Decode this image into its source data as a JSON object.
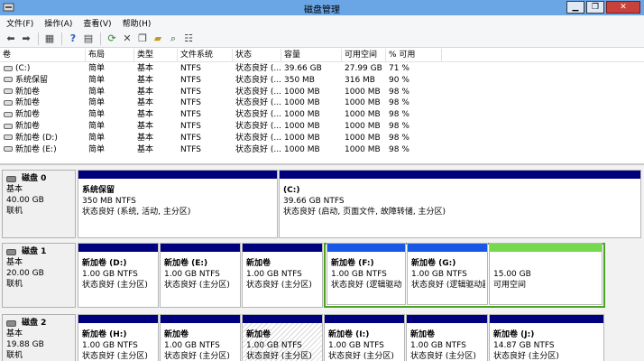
{
  "window": {
    "title": "磁盘管理",
    "min": "▁",
    "max": "❐",
    "close": "✕"
  },
  "menu": [
    "文件(F)",
    "操作(A)",
    "查看(V)",
    "帮助(H)"
  ],
  "toolbar": [
    "back-icon",
    "forward-icon",
    "console-icon",
    "help-icon",
    "properties-icon",
    "refresh-icon",
    "delete-icon",
    "copy-icon",
    "open-icon",
    "search-icon",
    "settings-icon"
  ],
  "volumes": {
    "headers": [
      "卷",
      "布局",
      "类型",
      "文件系统",
      "状态",
      "容量",
      "可用空间",
      "% 可用"
    ],
    "rows": [
      [
        "(C:)",
        "简单",
        "基本",
        "NTFS",
        "状态良好 (...",
        "39.66 GB",
        "27.99 GB",
        "71 %"
      ],
      [
        "系统保留",
        "简单",
        "基本",
        "NTFS",
        "状态良好 (...",
        "350 MB",
        "316 MB",
        "90 %"
      ],
      [
        "新加卷",
        "简单",
        "基本",
        "NTFS",
        "状态良好 (...",
        "1000 MB",
        "1000 MB",
        "98 %"
      ],
      [
        "新加卷",
        "简单",
        "基本",
        "NTFS",
        "状态良好 (...",
        "1000 MB",
        "1000 MB",
        "98 %"
      ],
      [
        "新加卷",
        "简单",
        "基本",
        "NTFS",
        "状态良好 (...",
        "1000 MB",
        "1000 MB",
        "98 %"
      ],
      [
        "新加卷",
        "简单",
        "基本",
        "NTFS",
        "状态良好 (...",
        "1000 MB",
        "1000 MB",
        "98 %"
      ],
      [
        "新加卷 (D:)",
        "简单",
        "基本",
        "NTFS",
        "状态良好 (...",
        "1000 MB",
        "1000 MB",
        "98 %"
      ],
      [
        "新加卷 (E:)",
        "简单",
        "基本",
        "NTFS",
        "状态良好 (...",
        "1000 MB",
        "1000 MB",
        "98 %"
      ]
    ]
  },
  "disks": [
    {
      "name": "磁盘 0",
      "type": "基本",
      "size": "40.00 GB",
      "status": "联机",
      "partitions": [
        {
          "title": "系统保留",
          "line1": "350 MB NTFS",
          "line2": "状态良好 (系统, 活动, 主分区)"
        },
        {
          "title": "(C:)",
          "line1": "39.66 GB NTFS",
          "line2": "状态良好 (启动, 页面文件, 故障转储, 主分区)"
        }
      ]
    },
    {
      "name": "磁盘 1",
      "type": "基本",
      "size": "20.00 GB",
      "status": "联机",
      "partitions": [
        {
          "title": "新加卷 (D:)",
          "line1": "1.00 GB NTFS",
          "line2": "状态良好 (主分区)"
        },
        {
          "title": "新加卷 (E:)",
          "line1": "1.00 GB NTFS",
          "line2": "状态良好 (主分区)"
        },
        {
          "title": "新加卷",
          "line1": "1.00 GB NTFS",
          "line2": "状态良好 (主分区)"
        },
        {
          "title": "新加卷 (F:)",
          "line1": "1.00 GB NTFS",
          "line2": "状态良好 (逻辑驱动"
        },
        {
          "title": "新加卷 (G:)",
          "line1": "1.00 GB NTFS",
          "line2": "状态良好 (逻辑驱动器"
        },
        {
          "title": "",
          "line1": "15.00 GB",
          "line2": "可用空间"
        }
      ]
    },
    {
      "name": "磁盘 2",
      "type": "基本",
      "size": "19.88 GB",
      "status": "联机",
      "partitions": [
        {
          "title": "新加卷 (H:)",
          "line1": "1.00 GB NTFS",
          "line2": "状态良好 (主分区)"
        },
        {
          "title": "新加卷",
          "line1": "1.00 GB NTFS",
          "line2": "状态良好 (主分区)"
        },
        {
          "title": "新加卷",
          "line1": "1.00 GB NTFS",
          "line2": "状态良好 (主分区)"
        },
        {
          "title": "新加卷 (I:)",
          "line1": "1.00 GB NTFS",
          "line2": "状态良好 (主分区)"
        },
        {
          "title": "新加卷",
          "line1": "1.00 GB NTFS",
          "line2": "状态良好 (主分区)"
        },
        {
          "title": "新加卷 (J:)",
          "line1": "14.87 GB NTFS",
          "line2": "状态良好 (主分区)"
        }
      ]
    }
  ],
  "colors": {
    "primary_bar": "#00007f",
    "logical_bar": "#1957e6",
    "free_bar": "#76d94d",
    "titlebar": "#6aa6e6"
  }
}
